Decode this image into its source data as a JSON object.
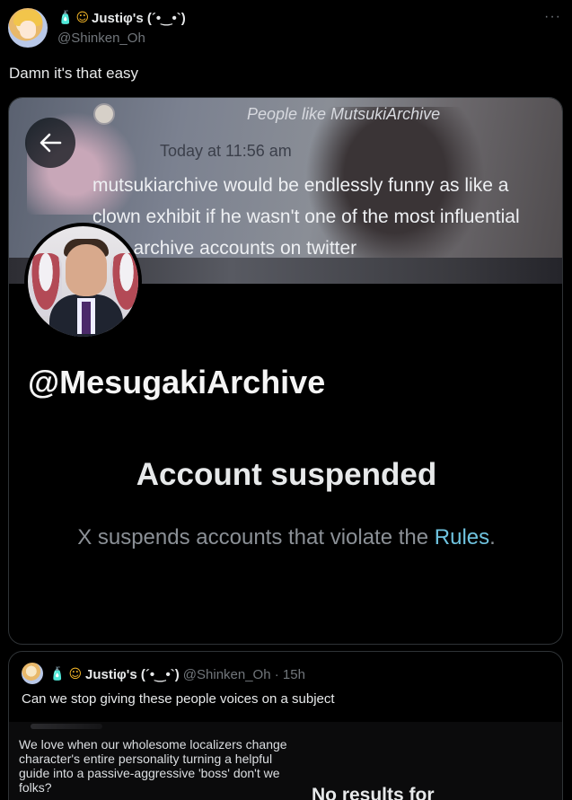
{
  "tweet": {
    "display_name": "Justiφ's (´•‿•`)",
    "handle": "@Shinken_Oh",
    "more_label": "···",
    "text": "Damn it's that easy"
  },
  "media": {
    "banner": {
      "title": "People like MutsukiArchive",
      "time": "Today at 11:56 am",
      "message": "mutsukiarchive would be endlessly funny as like a clown exhibit if he wasn't one of the most influential blue archive accounts on twitter"
    },
    "profile": {
      "handle": "@MesugakiArchive",
      "status_title": "Account suspended",
      "status_desc_prefix": "X suspends accounts that violate the ",
      "status_desc_link": "Rules",
      "status_desc_suffix": "."
    }
  },
  "quote_tweet": {
    "display_name": "Justiφ's (´•‿•`)",
    "meta": "@Shinken_Oh · 15h",
    "text": "Can we stop giving these people voices on a subject",
    "image_text": "We love when our wholesome localizers change character's entire personality turning a helpful guide into a passive-aggressive 'boss' don't we folks?",
    "image_right_text": "No results for"
  },
  "icons": {
    "back": "arrow-left-icon",
    "badge1": "bottle-emoji-icon",
    "badge2": "smiley-emoji-icon"
  }
}
